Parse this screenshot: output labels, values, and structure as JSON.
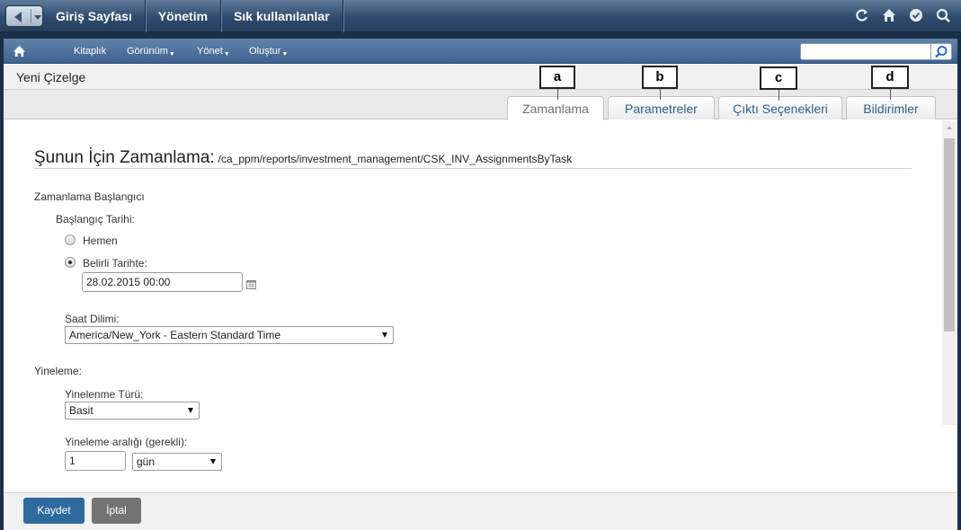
{
  "topbar": {
    "menu": [
      "Giriş Sayfası",
      "Yönetim",
      "Sık kullanılanlar"
    ],
    "icons": [
      "refresh-icon",
      "home-icon",
      "check-icon",
      "search-icon"
    ]
  },
  "menubar": {
    "items": [
      "Kitaplık",
      "Görünüm",
      "Yönet",
      "Oluştur"
    ],
    "search_value": ""
  },
  "page": {
    "title": "Yeni Çizelge"
  },
  "tabs": [
    {
      "label": "Zamanlama",
      "callout": "a",
      "active": true
    },
    {
      "label": "Parametreler",
      "callout": "b",
      "active": false
    },
    {
      "label": "Çıktı Seçenekleri",
      "callout": "c",
      "active": false
    },
    {
      "label": "Bildirimler",
      "callout": "d",
      "active": false
    }
  ],
  "form": {
    "heading": "Şunun İçin Zamanlama:",
    "path": "/ca_ppm/reports/investment_management/CSK_INV_AssignmentsByTask",
    "start_section": "Zamanlama Başlangıcı",
    "start_date_label": "Başlangıç Tarihi:",
    "radio_now": "Hemen",
    "radio_specific": "Belirli Tarihte:",
    "date_value": "28.02.2015 00:00",
    "timezone_label": "Saat Dilimi:",
    "timezone_value": "America/New_York - Eastern Standard Time",
    "repeat_section": "Yineleme:",
    "repeat_type_label": "Yinelenme Türü:",
    "repeat_type_value": "Basit",
    "interval_label": "Yineleme aralığı (gerekli):",
    "interval_value": "1",
    "interval_unit": "gün"
  },
  "buttons": {
    "save": "Kaydet",
    "cancel": "İptal"
  },
  "colors": {
    "primary_button": "#2e6a9e",
    "cancel_button": "#737373",
    "tab_text": "#2f5f91"
  }
}
